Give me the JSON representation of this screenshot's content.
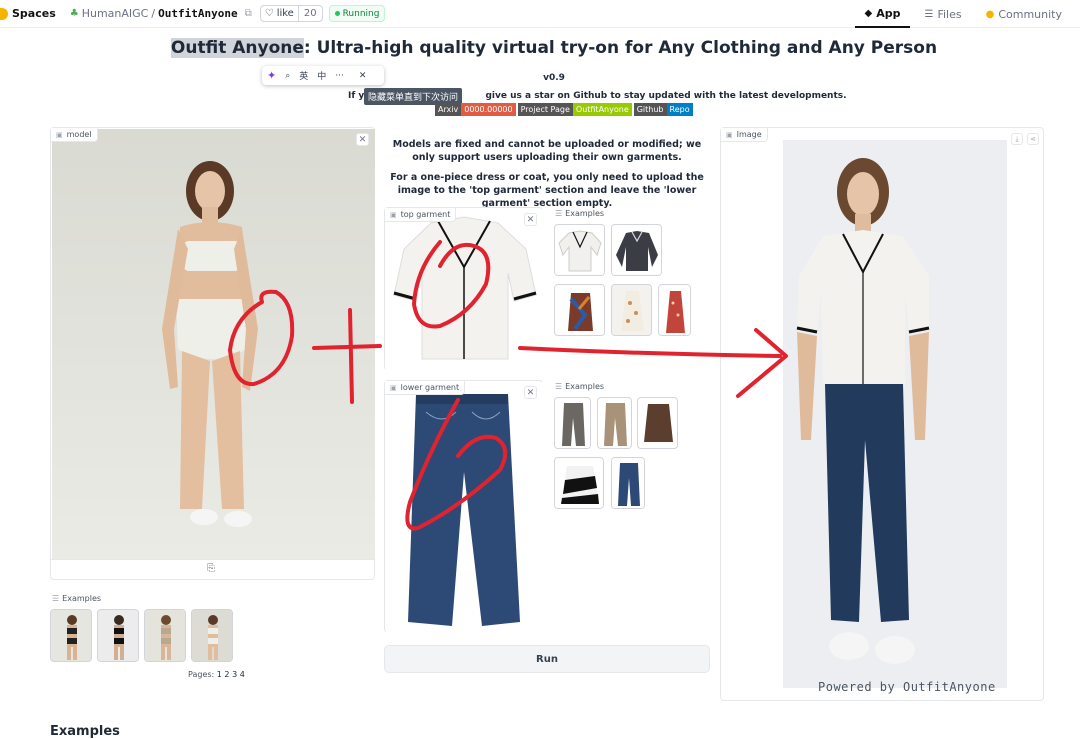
{
  "topbar": {
    "spaces_label": "Spaces",
    "org": "HumanAIGC",
    "separator": "/",
    "repo": "OutfitAnyone",
    "like_label": "like",
    "like_count": "20",
    "status": "Running",
    "tabs": [
      {
        "label": "App",
        "icon": "app-icon"
      },
      {
        "label": "Files",
        "icon": "files-icon"
      },
      {
        "label": "Community",
        "icon": "community-icon"
      }
    ]
  },
  "header": {
    "title_highlight": "Outfit Anyone",
    "title_rest": ": Ultra-high quality virtual try-on for Any Clothing and Any Person",
    "version": "v0.9",
    "subline_a": "If yo",
    "subline_b": "give us a star on Github to stay updated with the latest developments."
  },
  "popup": {
    "tooltip": "隐藏菜单直到下次访问",
    "btn_en": "英",
    "btn_zh": "中",
    "more": "···",
    "close": "✕"
  },
  "badges": [
    {
      "left": "Arxiv",
      "right": "0000.00000",
      "color": "#e05d44"
    },
    {
      "left": "Project Page",
      "right": "OutfitAnyone",
      "color": "#97ca00"
    },
    {
      "left": "Github",
      "right": "Repo",
      "color": "#007ec6"
    }
  ],
  "model_panel": {
    "label": "model",
    "examples_label": "Examples",
    "pages_label": "Pages:",
    "pages": [
      "1",
      "2",
      "3",
      "4"
    ]
  },
  "info": {
    "line1": "Models are fixed and cannot be uploaded or modified; we only support users uploading their own garments.",
    "line2": "For a one-piece dress or coat, you only need to upload the image to the 'top garment' section and leave the 'lower garment' section empty."
  },
  "top_garment": {
    "label": "top garment",
    "examples_label": "Examples"
  },
  "lower_garment": {
    "label": "lower garment",
    "examples_label": "Examples"
  },
  "run_button": "Run",
  "output_panel": {
    "label": "Image",
    "watermark": "Powered by OutfitAnyone"
  },
  "bottom_heading": "Examples",
  "colors": {
    "running_green": "#22c55e",
    "annotation_red": "#e0232e",
    "hf_yellow": "#f6b400"
  }
}
